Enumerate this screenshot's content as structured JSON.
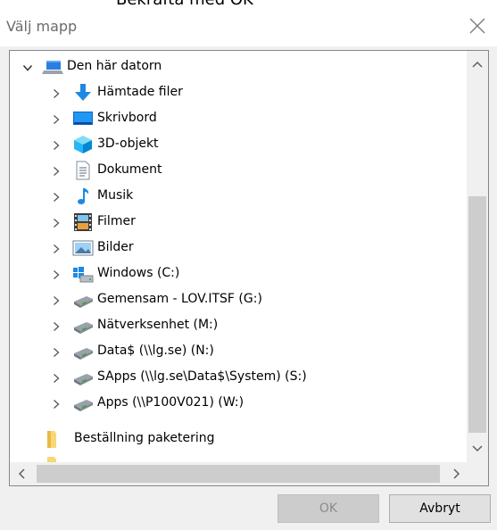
{
  "dialog": {
    "instruction": "Bekräfta med OK",
    "title": "Välj mapp"
  },
  "tree": {
    "root": {
      "label": "Den här datorn",
      "icon": "computer-icon"
    },
    "items": [
      {
        "label": "Hämtade filer",
        "icon": "download-arrow-icon"
      },
      {
        "label": "Skrivbord",
        "icon": "desktop-icon"
      },
      {
        "label": "3D-objekt",
        "icon": "3d-cube-icon"
      },
      {
        "label": "Dokument",
        "icon": "document-icon"
      },
      {
        "label": "Musik",
        "icon": "music-note-icon"
      },
      {
        "label": "Filmer",
        "icon": "film-icon"
      },
      {
        "label": "Bilder",
        "icon": "pictures-icon"
      },
      {
        "label": "Windows (C:)",
        "icon": "windows-drive-icon"
      },
      {
        "label": "Gemensam - LOV.ITSF (G:)",
        "icon": "network-drive-icon"
      },
      {
        "label": "Nätverksenhet (M:)",
        "icon": "network-drive-icon"
      },
      {
        "label": "Data$ (\\\\lg.se) (N:)",
        "icon": "network-drive-icon"
      },
      {
        "label": "SApps (\\\\lg.se\\Data$\\System) (S:)",
        "icon": "network-drive-icon"
      },
      {
        "label": "Apps (\\\\P100V021) (W:)",
        "icon": "network-drive-icon"
      }
    ],
    "bottom": {
      "label": "Beställning paketering",
      "icon": "folder-icon"
    }
  },
  "buttons": {
    "ok": "OK",
    "cancel": "Avbryt"
  },
  "colors": {
    "folder": "#f8d775",
    "blue": "#1e88e5",
    "border": "#828790"
  }
}
